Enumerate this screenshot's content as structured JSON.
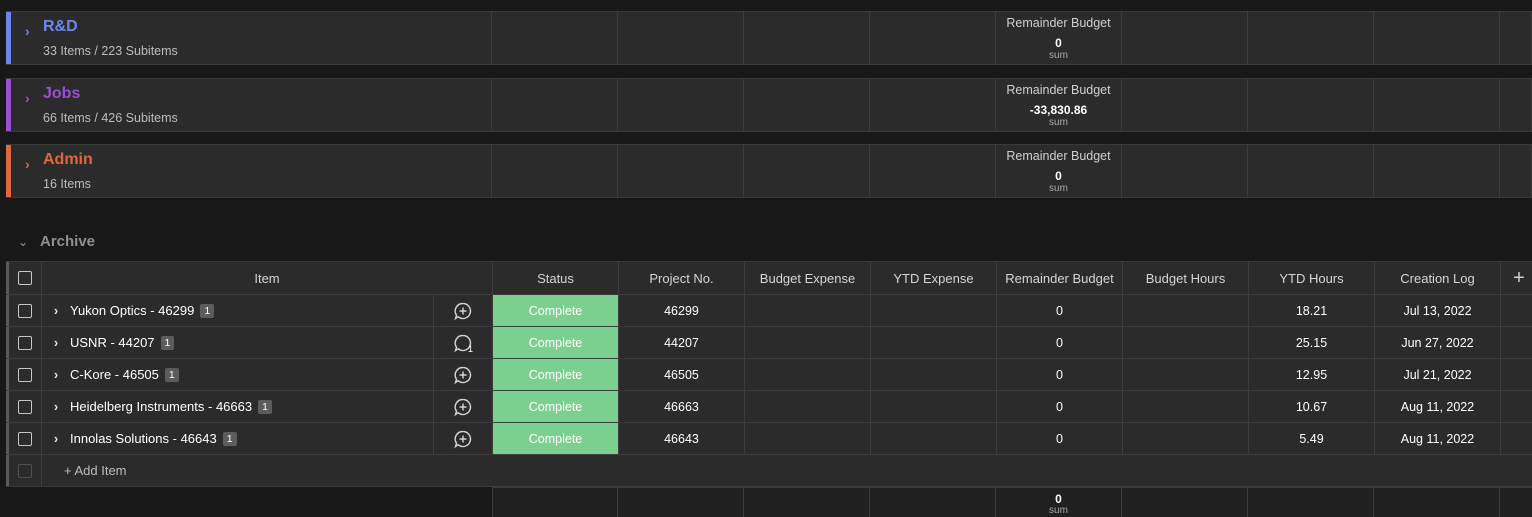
{
  "groups": [
    {
      "name": "R&D",
      "count": "33 Items / 223 Subitems",
      "color": "#6b86f0",
      "sum_label": "Remainder Budget",
      "sum_value": "0",
      "sum_caption": "sum"
    },
    {
      "name": "Jobs",
      "count": "66 Items / 426 Subitems",
      "color": "#9b4fd6",
      "sum_label": "Remainder Budget",
      "sum_value": "-33,830.86",
      "sum_caption": "sum"
    },
    {
      "name": "Admin",
      "count": "16 Items",
      "color": "#e0673b",
      "sum_label": "Remainder Budget",
      "sum_value": "0",
      "sum_caption": "sum"
    }
  ],
  "archive": {
    "name": "Archive",
    "columns": [
      "Item",
      "Status",
      "Project No.",
      "Budget Expense",
      "YTD Expense",
      "Remainder Budget",
      "Budget Hours",
      "YTD Hours",
      "Creation Log"
    ],
    "add_column_icon": "plus-icon",
    "rows": [
      {
        "item": "Yukon Optics - 46299",
        "subitems": "1",
        "updates": "",
        "status": "Complete",
        "project_no": "46299",
        "remainder": "0",
        "ytd_hours": "18.21",
        "creation": "Jul 13, 2022"
      },
      {
        "item": "USNR - 44207",
        "subitems": "1",
        "updates": "1",
        "status": "Complete",
        "project_no": "44207",
        "remainder": "0",
        "ytd_hours": "25.15",
        "creation": "Jun 27, 2022"
      },
      {
        "item": "C-Kore - 46505",
        "subitems": "1",
        "updates": "",
        "status": "Complete",
        "project_no": "46505",
        "remainder": "0",
        "ytd_hours": "12.95",
        "creation": "Jul 21, 2022"
      },
      {
        "item": "Heidelberg Instruments - 46663",
        "subitems": "1",
        "updates": "",
        "status": "Complete",
        "project_no": "46663",
        "remainder": "0",
        "ytd_hours": "10.67",
        "creation": "Aug 11, 2022"
      },
      {
        "item": "Innolas Solutions - 46643",
        "subitems": "1",
        "updates": "",
        "status": "Complete",
        "project_no": "46643",
        "remainder": "0",
        "ytd_hours": "5.49",
        "creation": "Aug 11, 2022"
      }
    ],
    "add_item_label": "+ Add Item",
    "footer_sum_value": "0",
    "footer_sum_caption": "sum",
    "status_color": "#7bcf8f"
  }
}
